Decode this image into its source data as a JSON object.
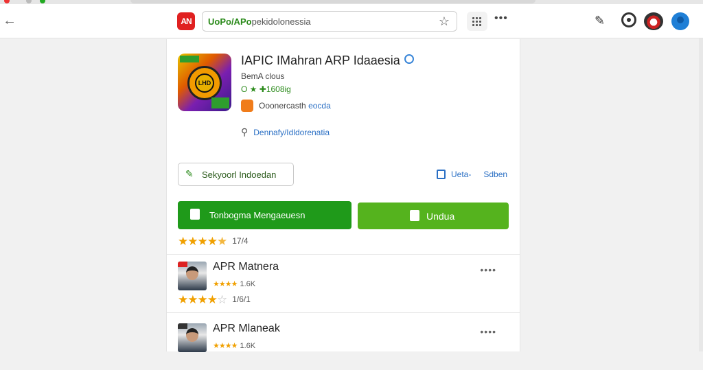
{
  "browser": {
    "url_host": "UoPo/APo",
    "url_path": "pekidolonessia",
    "site_logo_text": "AN"
  },
  "app": {
    "title": "IAPIC IMahran ARP Idaaesia",
    "developer": "BemA clous",
    "version": "O ★ ✚1608ig",
    "contact_label": "Ooonercasth",
    "contact_link": "eocda",
    "category": "Dennafy/Idldorenatia",
    "icon_text": "LHD"
  },
  "actions": {
    "select_label": "Sekyoorl Indoedan",
    "share_label": "Ueta-",
    "save_label": "Sdben",
    "download_main": "Tonbogma Mengaeuesn",
    "download_alt": "Undua"
  },
  "rating": {
    "stars": 4.5,
    "count": "17/4"
  },
  "related": [
    {
      "name": "APR Matnera",
      "mini_count": "1.6K",
      "rating": 4,
      "count": "1/6/1"
    },
    {
      "name": "APR Mlaneak",
      "mini_count": "1.6K",
      "rating": 4,
      "count": ""
    }
  ],
  "colors": {
    "primary_green": "#1f9a1a",
    "secondary_green": "#55b31e",
    "star": "#f0a000",
    "link": "#2a6fc4"
  }
}
